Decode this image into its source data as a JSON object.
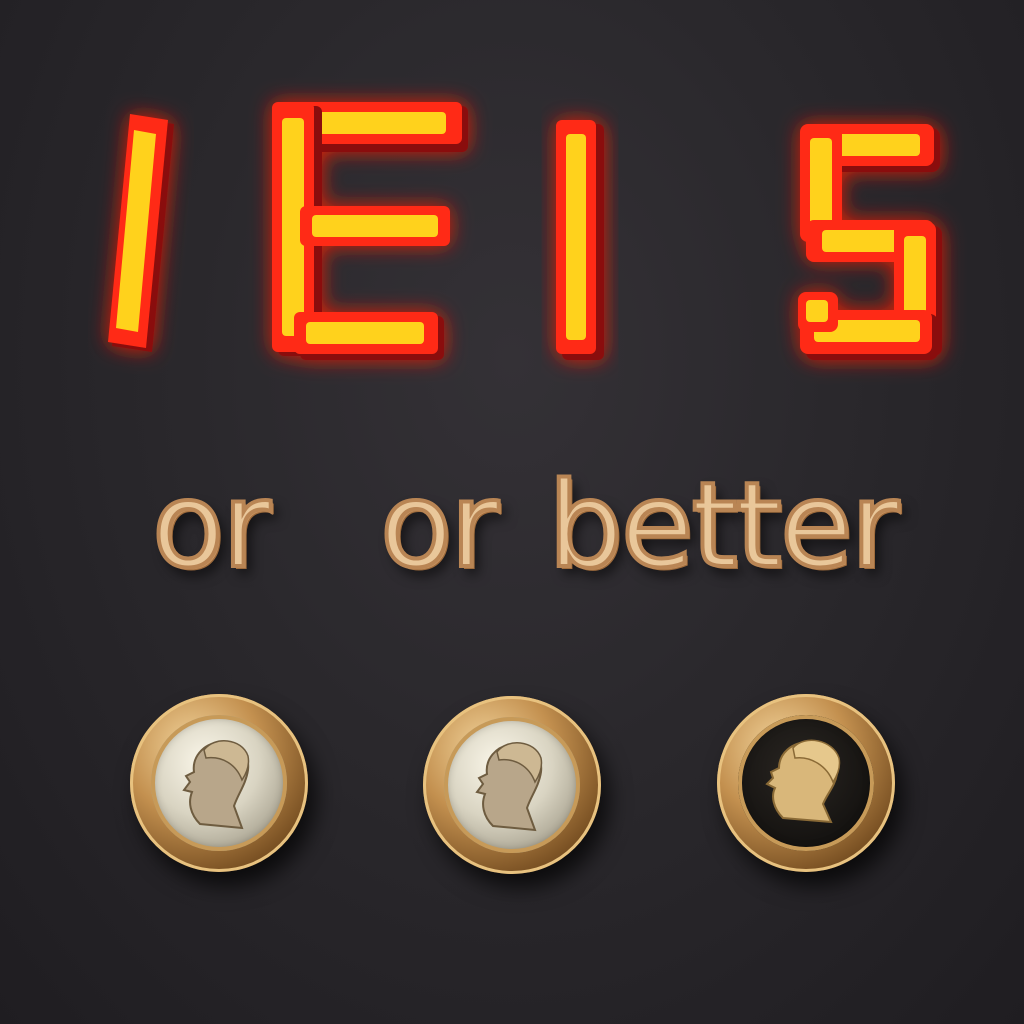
{
  "display": {
    "glyphs": [
      "I",
      "E",
      "I",
      "5"
    ],
    "colors": {
      "segment": "#ff2a14",
      "inner": "#ffd21a"
    }
  },
  "lettering": {
    "words": [
      "or",
      "or",
      "better"
    ],
    "color": "#e9c79a"
  },
  "coins": [
    {
      "face": "silver",
      "icon": "profile-head-icon"
    },
    {
      "face": "silver",
      "icon": "profile-head-icon"
    },
    {
      "face": "black",
      "icon": "profile-head-icon"
    }
  ]
}
